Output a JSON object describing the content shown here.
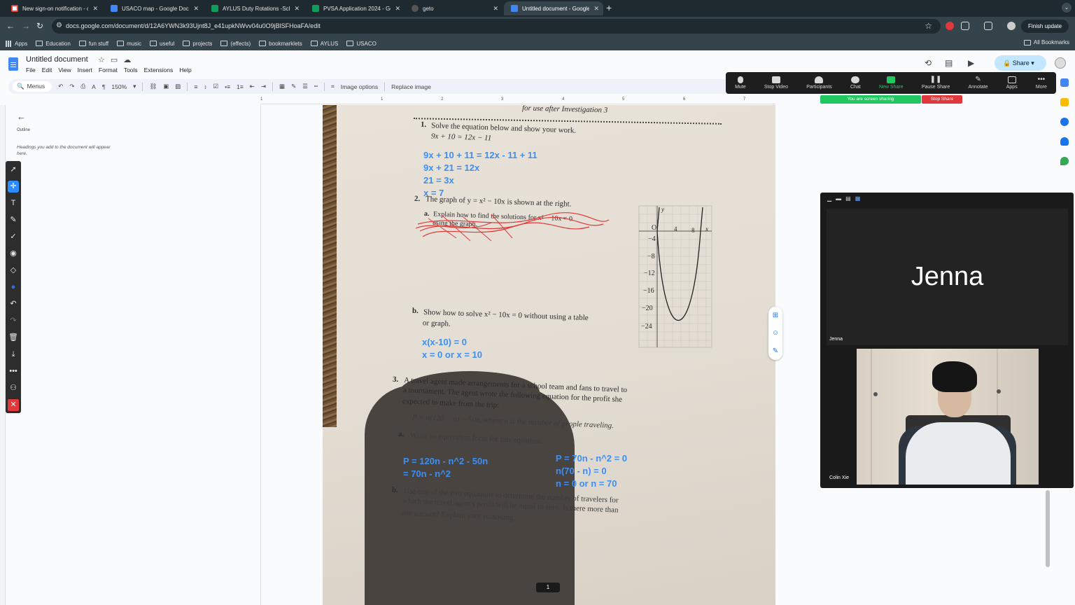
{
  "browser": {
    "tabs": [
      {
        "title": "New sign-on notification - co",
        "icon": "gmail-icon"
      },
      {
        "title": "USACO map - Google Docs",
        "icon": "docs-icon"
      },
      {
        "title": "AYLUS Duty Rotations -Sche",
        "icon": "sheets-icon"
      },
      {
        "title": "PVSA Application 2024 - Goo",
        "icon": "sheets-icon"
      },
      {
        "title": "geto",
        "icon": "github-icon"
      },
      {
        "title": "Untitled document - Google D",
        "icon": "docs-icon"
      }
    ],
    "url": "docs.google.com/document/d/12A6YWN3k93Ujnt8J_e41upkNWvv04u0O9jBlSFHoaFA/edit",
    "finish_update": "Finish update",
    "bookmarks": [
      "Apps",
      "Education",
      "fun stuff",
      "music",
      "useful",
      "projects",
      "(effects)",
      "bookmarklets",
      "AYLUS",
      "USACO"
    ],
    "all_bookmarks": "All Bookmarks"
  },
  "docs": {
    "title": "Untitled document",
    "menu": [
      "File",
      "Edit",
      "View",
      "Insert",
      "Format",
      "Tools",
      "Extensions",
      "Help"
    ],
    "share": "Share",
    "toolbar": {
      "menus": "Menus",
      "zoom": "150%",
      "image_options": "Image options",
      "replace_image": "Replace image"
    },
    "ruler": [
      "1",
      "1",
      "2",
      "3",
      "4",
      "5",
      "6",
      "7"
    ],
    "outline": {
      "label": "Outline",
      "hint": "Headings you add to the document will appear here."
    }
  },
  "zoom": {
    "controls": [
      "Mute",
      "Stop Video",
      "Participants",
      "Chat",
      "New Share",
      "Pause Share",
      "Annotate",
      "Apps",
      "More"
    ],
    "participants_count": "2",
    "sharing_status": "You are screen sharing",
    "stop_share": "Stop Share",
    "participants": [
      {
        "name": "Jenna",
        "label": "Jenna"
      },
      {
        "name": "Colin Xie",
        "label": "Colin Xie"
      }
    ]
  },
  "worksheet": {
    "header": "for use after Investigation 3",
    "q1_num": "1.",
    "q1_text": "Solve the equation below and show your work.",
    "q1_eq": "9x + 10 = 12x − 11",
    "q1_work": [
      "9x + 10 + 11 = 12x - 11 + 11",
      "9x + 21 = 12x",
      "21 = 3x",
      "x = 7"
    ],
    "q2_num": "2.",
    "q2_text": "The graph of y = x² − 10x is shown at the right.",
    "q2a_label": "a.",
    "q2a_text1": "Explain how to find the solutions for x² − 10x = 0",
    "q2a_text2": "using the graph.",
    "q2b_label": "b.",
    "q2b_text1": "Show how to solve x² − 10x = 0 without using a table",
    "q2b_text2": "or graph.",
    "q2b_work": [
      "x(x-10) = 0",
      "x = 0 or x = 10"
    ],
    "q3_num": "3.",
    "q3_text": [
      "A travel agent made arrangements for a school team and fans to travel to",
      "a tournament. The agent wrote the following equation for the profit she",
      "expected to make from the trip:"
    ],
    "q3_eq": "P = n(120 − n) − 50n, where n is the number of people traveling.",
    "q3a_label": "a.",
    "q3a_text": "Write an equivalent form for this equation.",
    "q3a_work_left": [
      "P = 120n - n^2 - 50n",
      "= 70n - n^2"
    ],
    "q3a_work_right": [
      "P = 70n - n^2 = 0",
      "n(70 - n) = 0",
      "n = 0 or n = 70"
    ],
    "q3b_label": "b.",
    "q3b_text": [
      "Use one of the two equations to determine the number of travelers for",
      "which the travel agent's profit will be equal to zero. Is there more than",
      "one answer? Explain your reasoning."
    ],
    "page_number": "1",
    "graph": {
      "x_ticks": [
        "O",
        "4",
        "8",
        "x"
      ],
      "y_label": "y",
      "y_ticks": [
        "−4",
        "−8",
        "−12",
        "−16",
        "−20",
        "−24"
      ]
    }
  },
  "colors": {
    "handwriting": "#3b8ff5",
    "scribble": "#e03a3a",
    "zoom_green": "#20c760",
    "zoom_red": "#e0383b",
    "share_btn": "#c2e7ff"
  }
}
